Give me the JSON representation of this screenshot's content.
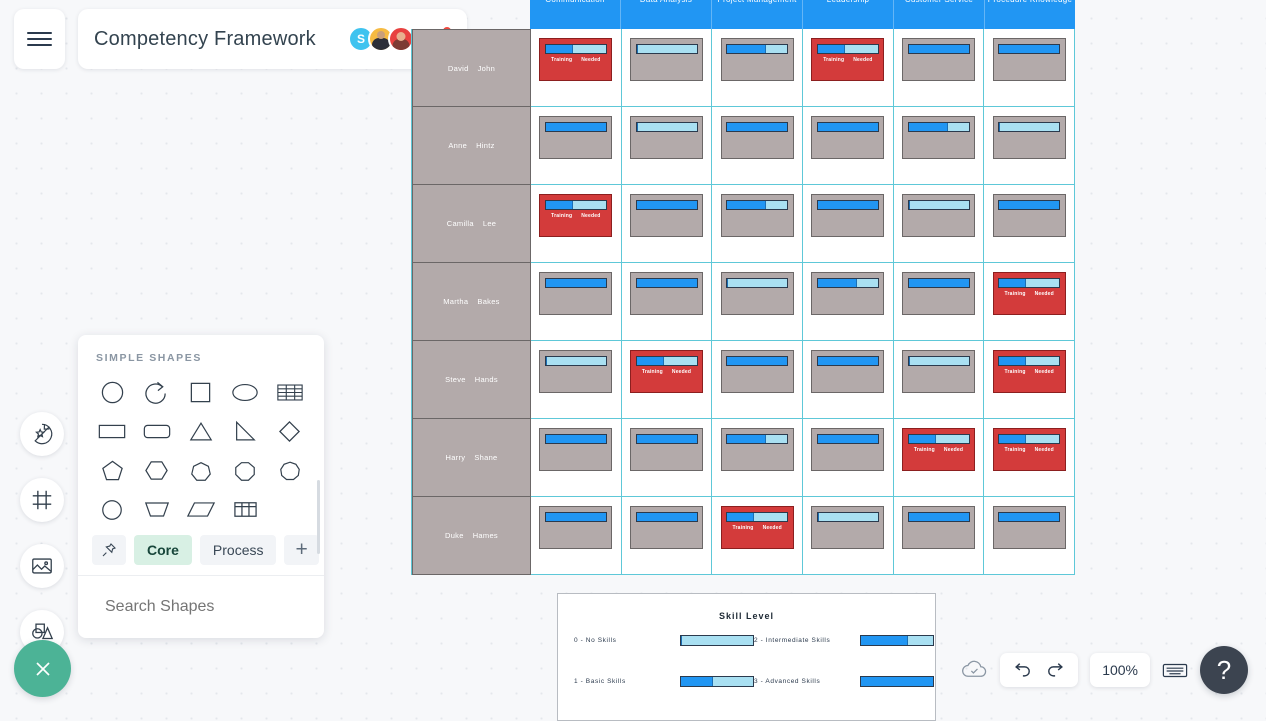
{
  "header": {
    "menu_icon": "hamburger-menu-icon",
    "doc_title": "Competency Framework",
    "avatars": [
      {
        "initial": "S",
        "kind": "letter",
        "color": "#3fc3ef"
      },
      {
        "initial": "",
        "kind": "photo",
        "color": "#f6bb42"
      },
      {
        "initial": "",
        "kind": "photo",
        "color": "#e8413f"
      }
    ],
    "call_icon": "phone-call-icon",
    "call_badge_color": "#f0483e"
  },
  "rail": {
    "items": [
      {
        "icon": "sticker-star-icon",
        "name": "stickers-tool"
      },
      {
        "icon": "frame-icon",
        "name": "frame-tool"
      },
      {
        "icon": "image-icon",
        "name": "image-tool"
      },
      {
        "icon": "shapes-icon",
        "name": "shapes-tool"
      }
    ],
    "close_icon": "close-x-icon",
    "close_color": "#4cb396"
  },
  "shapes_panel": {
    "title": "SIMPLE SHAPES",
    "shapes": [
      "circle",
      "arc-arrow",
      "square",
      "ellipse",
      "table-lines",
      "rectangle",
      "rounded-rectangle",
      "triangle",
      "right-triangle",
      "diamond",
      "pentagon",
      "hexagon",
      "heptagon",
      "octagon",
      "nonagon",
      "decagon",
      "trapezoid",
      "parallelogram",
      "table-grid"
    ],
    "tabs": [
      {
        "label": "",
        "icon": "pin-icon",
        "active": false
      },
      {
        "label": "Core",
        "icon": "",
        "active": true
      },
      {
        "label": "Process",
        "icon": "",
        "active": false
      },
      {
        "label": "+",
        "icon": "plus-icon",
        "active": false
      }
    ],
    "search_placeholder": "Search Shapes",
    "search_value": "",
    "more_icon": "kebab-menu-icon"
  },
  "matrix": {
    "columns": [
      "Communication",
      "Data   Analysis",
      "Project   Management",
      "Leadership",
      "Customer   Service",
      "Procedure Knowledge"
    ],
    "header_color": "#2196f3",
    "alert_color": "#d33b3b",
    "alert_label_left": "Training",
    "alert_label_right": "Needed",
    "rows": [
      {
        "first": "David",
        "last": "John",
        "cells": [
          {
            "level": 1,
            "alert": true
          },
          {
            "level": 0,
            "alert": false
          },
          {
            "level": 2,
            "alert": false
          },
          {
            "level": 1,
            "alert": true
          },
          {
            "level": 3,
            "alert": false
          },
          {
            "level": 3,
            "alert": false
          }
        ]
      },
      {
        "first": "Anne",
        "last": "Hintz",
        "cells": [
          {
            "level": 3,
            "alert": false
          },
          {
            "level": 0,
            "alert": false
          },
          {
            "level": 3,
            "alert": false
          },
          {
            "level": 3,
            "alert": false
          },
          {
            "level": 2,
            "alert": false
          },
          {
            "level": 0,
            "alert": false
          }
        ]
      },
      {
        "first": "Camilla",
        "last": "Lee",
        "cells": [
          {
            "level": 1,
            "alert": true
          },
          {
            "level": 3,
            "alert": false
          },
          {
            "level": 2,
            "alert": false
          },
          {
            "level": 3,
            "alert": false
          },
          {
            "level": 0,
            "alert": false
          },
          {
            "level": 3,
            "alert": false
          }
        ]
      },
      {
        "first": "Martha",
        "last": "Bakes",
        "cells": [
          {
            "level": 3,
            "alert": false
          },
          {
            "level": 3,
            "alert": false
          },
          {
            "level": 0,
            "alert": false
          },
          {
            "level": 2,
            "alert": false
          },
          {
            "level": 3,
            "alert": false
          },
          {
            "level": 1,
            "alert": true
          }
        ]
      },
      {
        "first": "Steve",
        "last": "Hands",
        "cells": [
          {
            "level": 0,
            "alert": false
          },
          {
            "level": 1,
            "alert": true
          },
          {
            "level": 3,
            "alert": false
          },
          {
            "level": 3,
            "alert": false
          },
          {
            "level": 0,
            "alert": false
          },
          {
            "level": 1,
            "alert": true
          }
        ]
      },
      {
        "first": "Harry",
        "last": "Shane",
        "cells": [
          {
            "level": 3,
            "alert": false
          },
          {
            "level": 3,
            "alert": false
          },
          {
            "level": 2,
            "alert": false
          },
          {
            "level": 3,
            "alert": false
          },
          {
            "level": 1,
            "alert": true
          },
          {
            "level": 1,
            "alert": true
          }
        ]
      },
      {
        "first": "Duke",
        "last": "Hames",
        "cells": [
          {
            "level": 3,
            "alert": false
          },
          {
            "level": 3,
            "alert": false
          },
          {
            "level": 1,
            "alert": true
          },
          {
            "level": 0,
            "alert": false
          },
          {
            "level": 3,
            "alert": false
          },
          {
            "level": 3,
            "alert": false
          }
        ]
      }
    ]
  },
  "legend": {
    "title": "Skill   Level",
    "items": [
      {
        "label": "0 -  No   Skills",
        "level": 0
      },
      {
        "label": "2 -  Intermediate     Skills",
        "level": 2
      },
      {
        "label": "1 - Basic   Skills",
        "level": 1
      },
      {
        "label": "3 -  Advanced     Skills",
        "level": 3
      }
    ],
    "level_percent": [
      0,
      45,
      65,
      100
    ]
  },
  "bottom_bar": {
    "cloud_icon": "cloud-saved-icon",
    "undo_icon": "undo-icon",
    "redo_icon": "redo-icon",
    "zoom_level": "100%",
    "keyboard_icon": "keyboard-icon",
    "help_label": "?"
  }
}
